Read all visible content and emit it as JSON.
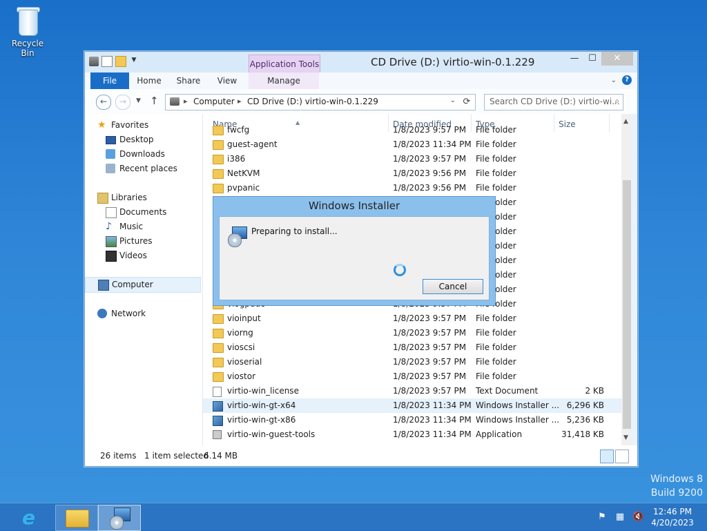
{
  "desktop": {
    "recycle_bin_label": "Recycle Bin",
    "watermark_line1": "Windows 8",
    "watermark_line2": "Build 9200"
  },
  "window": {
    "title": "CD Drive (D:) virtio-win-0.1.229",
    "contextual_tab": "Application Tools",
    "controls": {
      "minimize": "—",
      "maximize": "☐",
      "close": "✕"
    }
  },
  "ribbon": {
    "tabs": [
      {
        "label": "File"
      },
      {
        "label": "Home"
      },
      {
        "label": "Share"
      },
      {
        "label": "View"
      },
      {
        "label": "Manage"
      }
    ]
  },
  "address": {
    "crumbs": [
      "Computer",
      "CD Drive (D:) virtio-win-0.1.229"
    ],
    "search_placeholder": "Search CD Drive (D:) virtio-wi..."
  },
  "nav": {
    "favorites": "Favorites",
    "desktop": "Desktop",
    "downloads": "Downloads",
    "recent": "Recent places",
    "libraries": "Libraries",
    "documents": "Documents",
    "music": "Music",
    "pictures": "Pictures",
    "videos": "Videos",
    "computer": "Computer",
    "network": "Network"
  },
  "columns": {
    "name": "Name",
    "date": "Date modified",
    "type": "Type",
    "size": "Size"
  },
  "files": [
    {
      "name": "fwcfg",
      "date": "1/8/2023 9:57 PM",
      "type": "File folder",
      "size": "",
      "icon": "folder-icon"
    },
    {
      "name": "guest-agent",
      "date": "1/8/2023 11:34 PM",
      "type": "File folder",
      "size": "",
      "icon": "folder-icon"
    },
    {
      "name": "i386",
      "date": "1/8/2023 9:57 PM",
      "type": "File folder",
      "size": "",
      "icon": "folder-icon"
    },
    {
      "name": "NetKVM",
      "date": "1/8/2023 9:56 PM",
      "type": "File folder",
      "size": "",
      "icon": "folder-icon"
    },
    {
      "name": "pvpanic",
      "date": "1/8/2023 9:56 PM",
      "type": "File folder",
      "size": "",
      "icon": "folder-icon"
    },
    {
      "name": "",
      "date": "",
      "type": "File folder",
      "size": "",
      "icon": "folder-icon"
    },
    {
      "name": "",
      "date": "",
      "type": "File folder",
      "size": "",
      "icon": "folder-icon"
    },
    {
      "name": "",
      "date": "",
      "type": "File folder",
      "size": "",
      "icon": "folder-icon"
    },
    {
      "name": "",
      "date": "",
      "type": "File folder",
      "size": "",
      "icon": "folder-icon"
    },
    {
      "name": "",
      "date": "",
      "type": "File folder",
      "size": "",
      "icon": "folder-icon"
    },
    {
      "name": "",
      "date": "",
      "type": "File folder",
      "size": "",
      "icon": "folder-icon"
    },
    {
      "name": "",
      "date": "",
      "type": "File folder",
      "size": "",
      "icon": "folder-icon"
    },
    {
      "name": "viogpudo",
      "date": "1/8/2023 9:57 PM",
      "type": "File folder",
      "size": "",
      "icon": "folder-icon"
    },
    {
      "name": "vioinput",
      "date": "1/8/2023 9:57 PM",
      "type": "File folder",
      "size": "",
      "icon": "folder-icon"
    },
    {
      "name": "viorng",
      "date": "1/8/2023 9:57 PM",
      "type": "File folder",
      "size": "",
      "icon": "folder-icon"
    },
    {
      "name": "vioscsi",
      "date": "1/8/2023 9:57 PM",
      "type": "File folder",
      "size": "",
      "icon": "folder-icon"
    },
    {
      "name": "vioserial",
      "date": "1/8/2023 9:57 PM",
      "type": "File folder",
      "size": "",
      "icon": "folder-icon"
    },
    {
      "name": "viostor",
      "date": "1/8/2023 9:57 PM",
      "type": "File folder",
      "size": "",
      "icon": "folder-icon"
    },
    {
      "name": "virtio-win_license",
      "date": "1/8/2023 9:57 PM",
      "type": "Text Document",
      "size": "2 KB",
      "icon": "text-file-icon"
    },
    {
      "name": "virtio-win-gt-x64",
      "date": "1/8/2023 11:34 PM",
      "type": "Windows Installer ...",
      "size": "6,296 KB",
      "icon": "installer-icon",
      "selected": true
    },
    {
      "name": "virtio-win-gt-x86",
      "date": "1/8/2023 11:34 PM",
      "type": "Windows Installer ...",
      "size": "5,236 KB",
      "icon": "installer-icon"
    },
    {
      "name": "virtio-win-guest-tools",
      "date": "1/8/2023 11:34 PM",
      "type": "Application",
      "size": "31,418 KB",
      "icon": "application-icon"
    }
  ],
  "status": {
    "items": "26 items",
    "selection": "1 item selected",
    "size": "6.14 MB"
  },
  "dialog": {
    "title": "Windows Installer",
    "message": "Preparing to install...",
    "cancel_label": "Cancel"
  },
  "taskbar": {
    "time": "12:46 PM",
    "date": "4/20/2023"
  },
  "colors": {
    "accent": "#1a6dc7",
    "selection": "#e5f1fb",
    "contextual_tab": "#e5d3f1"
  }
}
